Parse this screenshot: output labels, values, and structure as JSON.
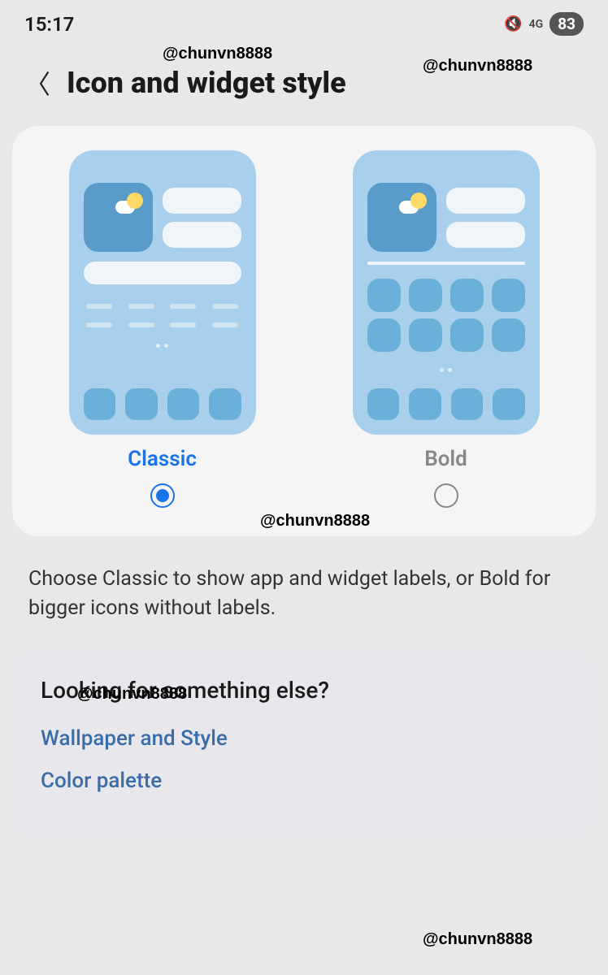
{
  "status": {
    "time": "15:17",
    "signal": "4G",
    "battery": "83"
  },
  "header": {
    "title": "Icon and widget style"
  },
  "options": {
    "classic": {
      "label": "Classic",
      "selected": true
    },
    "bold": {
      "label": "Bold",
      "selected": false
    }
  },
  "description": "Choose Classic to show app and widget labels, or Bold for bigger icons without labels.",
  "suggestions": {
    "title": "Looking for something else?",
    "links": [
      "Wallpaper and Style",
      "Color palette"
    ]
  },
  "watermark": "@chunvn8888"
}
